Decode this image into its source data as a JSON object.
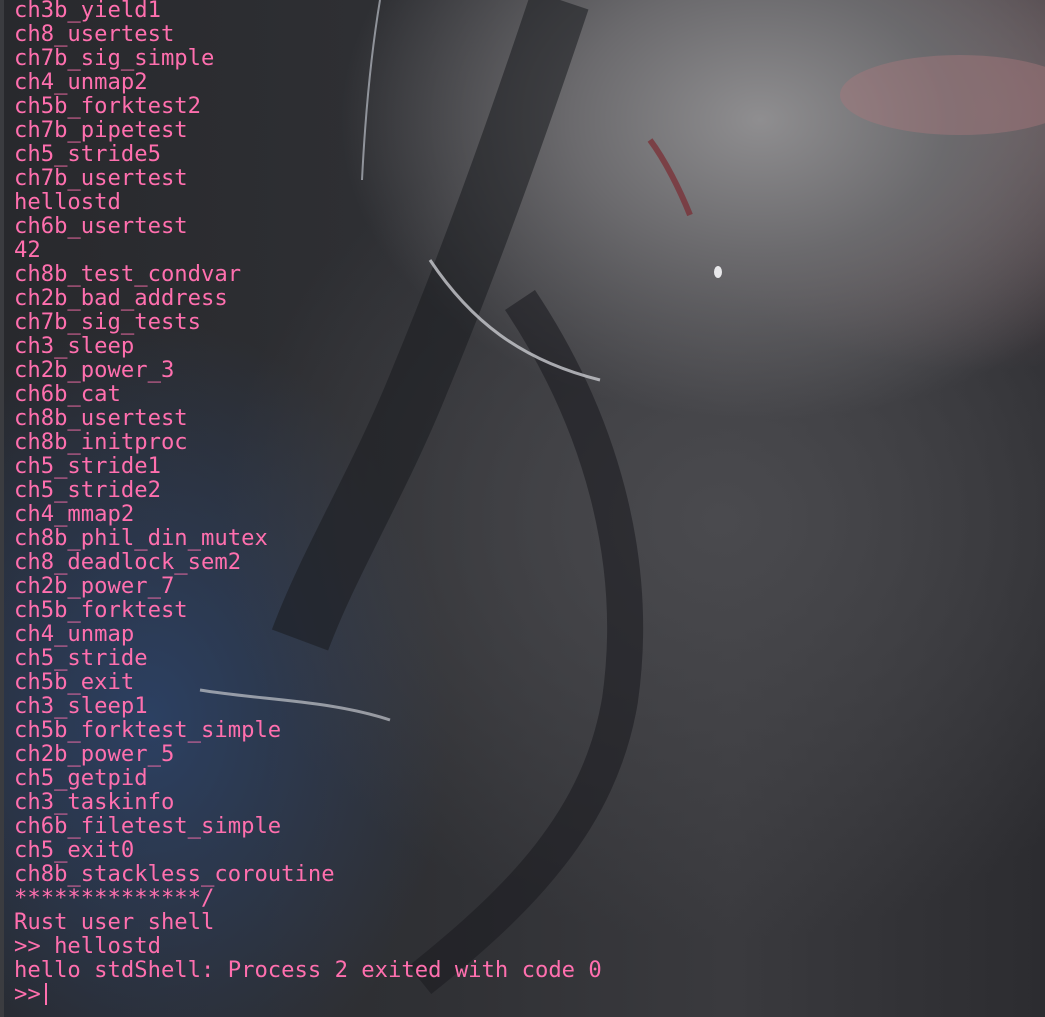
{
  "terminal": {
    "colors": {
      "text": "#ff6fae",
      "background": "#2c2d31"
    },
    "lines": [
      "ch3b_yield1",
      "ch8_usertest",
      "ch7b_sig_simple",
      "ch4_unmap2",
      "ch5b_forktest2",
      "ch7b_pipetest",
      "ch5_stride5",
      "ch7b_usertest",
      "hellostd",
      "ch6b_usertest",
      "42",
      "ch8b_test_condvar",
      "ch2b_bad_address",
      "ch7b_sig_tests",
      "ch3_sleep",
      "ch2b_power_3",
      "ch6b_cat",
      "ch8b_usertest",
      "ch8b_initproc",
      "ch5_stride1",
      "ch5_stride2",
      "ch4_mmap2",
      "ch8b_phil_din_mutex",
      "ch8_deadlock_sem2",
      "ch2b_power_7",
      "ch5b_forktest",
      "ch4_unmap",
      "ch5_stride",
      "ch5b_exit",
      "ch3_sleep1",
      "ch5b_forktest_simple",
      "ch2b_power_5",
      "ch5_getpid",
      "ch3_taskinfo",
      "ch6b_filetest_simple",
      "ch5_exit0",
      "ch8b_stackless_coroutine",
      "**************/",
      "Rust user shell",
      ">> hellostd",
      "hello stdShell: Process 2 exited with code 0"
    ],
    "prompt": ">> "
  }
}
